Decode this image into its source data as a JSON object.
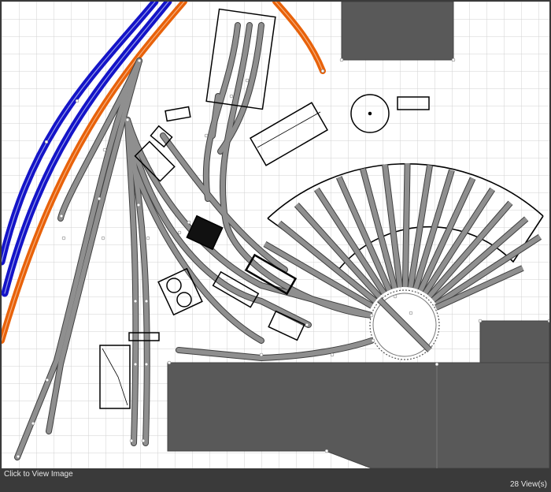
{
  "viewer": {
    "caption": "Click to View Image",
    "views": "28 View(s)"
  },
  "colors": {
    "grid": "#d2d2d2",
    "track_bed": "#8f8f8f",
    "track_edge": "#404040",
    "mainline_blue": "#1414c8",
    "mainline_orange": "#e8620a",
    "structure_fill": "#595959",
    "outline": "#000000"
  }
}
